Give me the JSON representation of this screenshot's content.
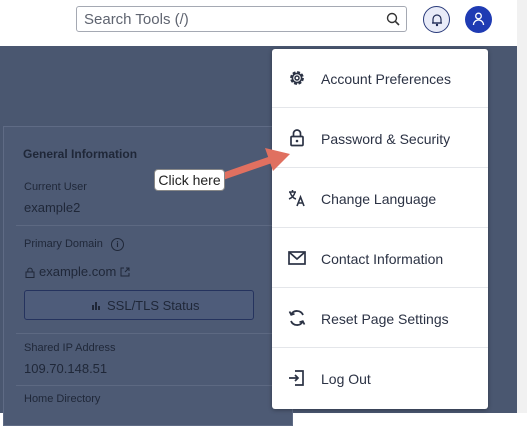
{
  "header": {
    "search_placeholder": "Search Tools (/)",
    "search_icon": "search-icon",
    "bell_icon": "bell-icon",
    "user_icon": "user-icon"
  },
  "general_info": {
    "title": "General Information",
    "current_user_label": "Current User",
    "current_user_value": "example2",
    "primary_domain_label": "Primary Domain",
    "primary_domain_value": "example.com",
    "ssl_button_label": "SSL/TLS Status",
    "shared_ip_label": "Shared IP Address",
    "shared_ip_value": "109.70.148.51",
    "home_directory_label": "Home Directory"
  },
  "user_menu": {
    "items": [
      {
        "label": "Account Preferences",
        "icon": "gear-icon"
      },
      {
        "label": "Password & Security",
        "icon": "lock-icon"
      },
      {
        "label": "Change Language",
        "icon": "translate-icon"
      },
      {
        "label": "Contact Information",
        "icon": "envelope-icon"
      },
      {
        "label": "Reset Page Settings",
        "icon": "refresh-icon"
      },
      {
        "label": "Log Out",
        "icon": "logout-icon"
      }
    ]
  },
  "annotation": {
    "callout_text": "Click here",
    "arrow_color": "#e07060"
  },
  "colors": {
    "overlay_bg": "#4a5770",
    "brand_blue": "#1f3bb3",
    "menu_text": "#2b3244"
  }
}
